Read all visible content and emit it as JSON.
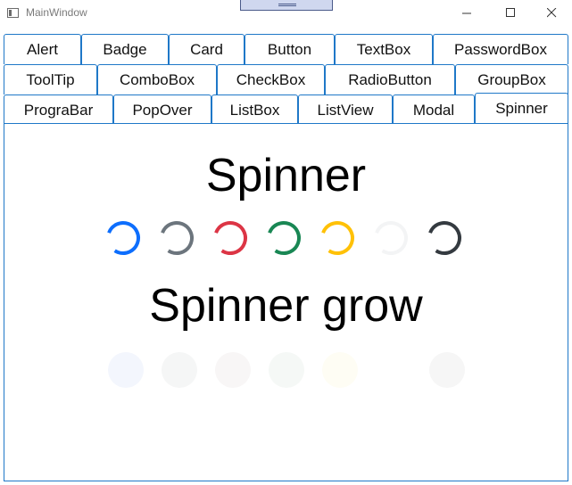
{
  "window": {
    "title": "MainWindow"
  },
  "tabs": {
    "row1": [
      "Alert",
      "Badge",
      "Card",
      "Button",
      "TextBox",
      "PasswordBox"
    ],
    "row2": [
      "ToolTip",
      "ComboBox",
      "CheckBox",
      "RadioButton",
      "GroupBox"
    ],
    "row3": [
      "PrograBar",
      "PopOver",
      "ListBox",
      "ListView",
      "Modal",
      "Spinner"
    ],
    "selected": "Spinner"
  },
  "content": {
    "spinner_heading": "Spinner",
    "spinner_grow_heading": "Spinner grow",
    "spinner_colors": [
      "#0d6efd",
      "#6c757d",
      "#dc3545",
      "#198754",
      "#ffc107",
      "#f8f9fa",
      "#212529"
    ],
    "grow_colors": [
      "#f2f6fd",
      "#f4f5f6",
      "#fdf3f4",
      "#f3f8f5",
      "#fffcf0",
      "#ffffff",
      "#f5f5f5"
    ]
  },
  "icons": {
    "minimize": "minimize-icon",
    "maximize": "maximize-icon",
    "close": "close-icon",
    "app": "app-window-icon"
  }
}
